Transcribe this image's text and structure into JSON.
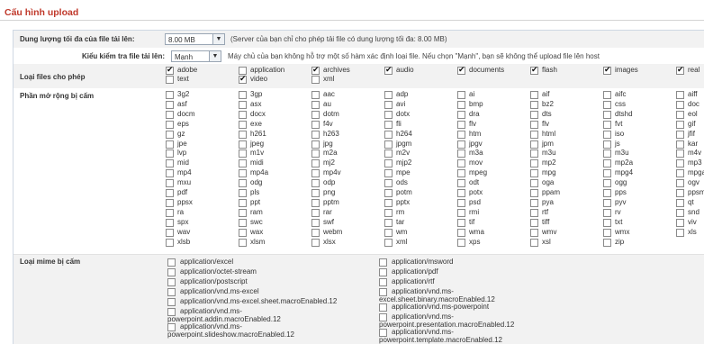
{
  "page_title": "Cấu hình upload",
  "max_size": {
    "label": "Dung lượng tối đa của file tải lên:",
    "value": "8.00 MB",
    "note": "(Server của bạn chỉ cho phép tải file có dung lượng tối đa: 8.00 MB)"
  },
  "check_type": {
    "label": "Kiểu kiểm tra file tải lên:",
    "value": "Mạnh",
    "note": "Máy chủ của bạn không hỗ trợ một số hàm xác định loại file. Nếu chọn \"Mạnh\", bạn sẽ không thể upload file lên host"
  },
  "allowed_types": {
    "label": "Loại files cho phép",
    "items": [
      {
        "name": "adobe",
        "checked": true
      },
      {
        "name": "application",
        "checked": false
      },
      {
        "name": "archives",
        "checked": true
      },
      {
        "name": "audio",
        "checked": true
      },
      {
        "name": "documents",
        "checked": true
      },
      {
        "name": "flash",
        "checked": true
      },
      {
        "name": "images",
        "checked": true
      },
      {
        "name": "real",
        "checked": true
      },
      {
        "name": "text",
        "checked": false
      },
      {
        "name": "video",
        "checked": true
      },
      {
        "name": "xml",
        "checked": false
      }
    ]
  },
  "forbidden_ext": {
    "label": "Phần mở rộng bị cấm",
    "items": [
      "3g2",
      "3gp",
      "aac",
      "adp",
      "ai",
      "aif",
      "aifc",
      "aiff",
      "asf",
      "asx",
      "au",
      "avi",
      "bmp",
      "bz2",
      "css",
      "doc",
      "docm",
      "docx",
      "dotm",
      "dotx",
      "dra",
      "dts",
      "dtshd",
      "eol",
      "eps",
      "exe",
      "f4v",
      "fli",
      "flv",
      "flv",
      "fvt",
      "gif",
      "gz",
      "h261",
      "h263",
      "h264",
      "htm",
      "html",
      "iso",
      "jfif",
      "jpe",
      "jpeg",
      "jpg",
      "jpgm",
      "jpgv",
      "jpm",
      "js",
      "kar",
      "lvp",
      "m1v",
      "m2a",
      "m2v",
      "m3a",
      "m3u",
      "m3u",
      "m4v",
      "mid",
      "midi",
      "mj2",
      "mjp2",
      "mov",
      "mp2",
      "mp2a",
      "mp3",
      "mp4",
      "mp4a",
      "mp4v",
      "mpe",
      "mpeg",
      "mpg",
      "mpg4",
      "mpga",
      "mxu",
      "odg",
      "odp",
      "ods",
      "odt",
      "oga",
      "ogg",
      "ogv",
      "pdf",
      "pls",
      "png",
      "potm",
      "potx",
      "ppam",
      "pps",
      "ppsm",
      "ppsx",
      "ppt",
      "pptm",
      "pptx",
      "psd",
      "pya",
      "pyv",
      "qt",
      "ra",
      "ram",
      "rar",
      "rm",
      "rmi",
      "rtf",
      "rv",
      "snd",
      "spx",
      "swc",
      "swf",
      "tar",
      "tif",
      "tiff",
      "txt",
      "viv",
      "wav",
      "wax",
      "webm",
      "wm",
      "wma",
      "wmv",
      "wmx",
      "xls",
      "xlsb",
      "xlsm",
      "xlsx",
      "xml",
      "xps",
      "xsl",
      "zip"
    ]
  },
  "forbidden_mime": {
    "label": "Loại mime bị cấm",
    "left": [
      {
        "lines": [
          "application/excel"
        ]
      },
      {
        "lines": [
          "application/octet-stream"
        ]
      },
      {
        "lines": [
          "application/postscript"
        ]
      },
      {
        "lines": [
          "application/vnd.ms-excel"
        ]
      },
      {
        "lines": [
          "application/vnd.ms-excel.sheet.macroEnabled.12"
        ]
      },
      {
        "lines": [
          "application/vnd.ms-",
          "powerpoint.addin.macroEnabled.12"
        ]
      },
      {
        "lines": [
          "application/vnd.ms-",
          "powerpoint.slideshow.macroEnabled.12"
        ]
      }
    ],
    "right": [
      {
        "lines": [
          "application/msword"
        ]
      },
      {
        "lines": [
          "application/pdf"
        ]
      },
      {
        "lines": [
          "application/rtf"
        ]
      },
      {
        "lines": [
          "application/vnd.ms-",
          "excel.sheet.binary.macroEnabled.12"
        ]
      },
      {
        "lines": [
          "application/vnd.ms-powerpoint"
        ]
      },
      {
        "lines": [
          "application/vnd.ms-",
          "powerpoint.presentation.macroEnabled.12"
        ]
      },
      {
        "lines": [
          "application/vnd.ms-",
          "powerpoint.template.macroEnabled.12"
        ]
      }
    ]
  }
}
